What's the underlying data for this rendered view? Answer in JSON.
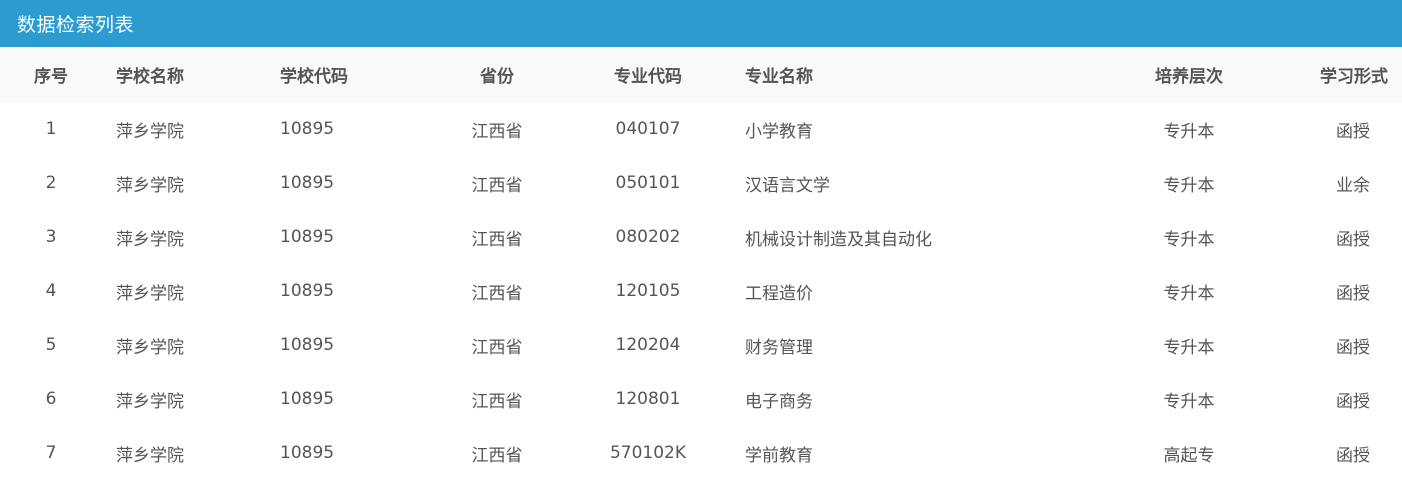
{
  "panel": {
    "title": "数据检索列表"
  },
  "table": {
    "headers": {
      "index": "序号",
      "school_name": "学校名称",
      "school_code": "学校代码",
      "province": "省份",
      "major_code": "专业代码",
      "major_name": "专业名称",
      "level": "培养层次",
      "study_form": "学习形式"
    },
    "rows": [
      {
        "index": "1",
        "school_name": "萍乡学院",
        "school_code": "10895",
        "province": "江西省",
        "major_code": "040107",
        "major_name": "小学教育",
        "level": "专升本",
        "study_form": "函授"
      },
      {
        "index": "2",
        "school_name": "萍乡学院",
        "school_code": "10895",
        "province": "江西省",
        "major_code": "050101",
        "major_name": "汉语言文学",
        "level": "专升本",
        "study_form": "业余"
      },
      {
        "index": "3",
        "school_name": "萍乡学院",
        "school_code": "10895",
        "province": "江西省",
        "major_code": "080202",
        "major_name": "机械设计制造及其自动化",
        "level": "专升本",
        "study_form": "函授"
      },
      {
        "index": "4",
        "school_name": "萍乡学院",
        "school_code": "10895",
        "province": "江西省",
        "major_code": "120105",
        "major_name": "工程造价",
        "level": "专升本",
        "study_form": "函授"
      },
      {
        "index": "5",
        "school_name": "萍乡学院",
        "school_code": "10895",
        "province": "江西省",
        "major_code": "120204",
        "major_name": "财务管理",
        "level": "专升本",
        "study_form": "函授"
      },
      {
        "index": "6",
        "school_name": "萍乡学院",
        "school_code": "10895",
        "province": "江西省",
        "major_code": "120801",
        "major_name": "电子商务",
        "level": "专升本",
        "study_form": "函授"
      },
      {
        "index": "7",
        "school_name": "萍乡学院",
        "school_code": "10895",
        "province": "江西省",
        "major_code": "570102K",
        "major_name": "学前教育",
        "level": "高起专",
        "study_form": "函授"
      }
    ]
  },
  "colors": {
    "header_bar": "#2b9bd0",
    "table_head_bg": "#f9f9f9",
    "text": "#555555"
  }
}
